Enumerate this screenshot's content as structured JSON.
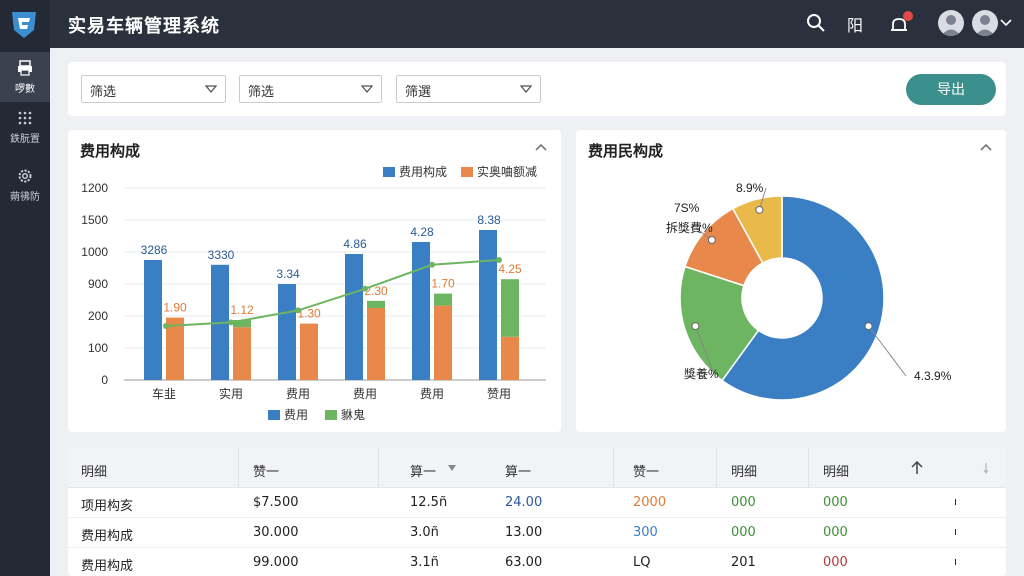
{
  "app": {
    "title": "实易车辆管理系统"
  },
  "topbar": {
    "text_icon": "阳"
  },
  "sidebar": {
    "items": [
      {
        "label": "啰數",
        "icon": "printer-icon"
      },
      {
        "label": "鉄朊置",
        "icon": "grid-dots-icon"
      },
      {
        "label": "蒴彿防",
        "icon": "gear-icon"
      }
    ]
  },
  "filters": {
    "items": [
      {
        "value": "筛选"
      },
      {
        "value": "筛选"
      },
      {
        "value": "筛選"
      }
    ],
    "export_label": "导出"
  },
  "bar_card": {
    "title": "费用构成"
  },
  "pie_card": {
    "title": "费用民构成"
  },
  "colors": {
    "blue": "#3a7fc4",
    "orange": "#e8884a",
    "green": "#6db561",
    "yellow": "#e9b94a",
    "teal": "#3b8f8c"
  },
  "chart_data": [
    {
      "type": "bar",
      "title": "费用构成",
      "legend_top": [
        "费用构成",
        "实奥㖆额减"
      ],
      "legend_bottom": [
        "费用",
        "貅鬼"
      ],
      "categories": [
        "车韭",
        "实用",
        "费用",
        "费用",
        "费用",
        "赞用"
      ],
      "yticks": [
        "0",
        "100",
        "200",
        "900",
        "1000",
        "1500",
        "1200"
      ],
      "series": [
        {
          "name": "费用构成",
          "color": "#3a7fc4",
          "values": [
            1000,
            960,
            800,
            1050,
            1150,
            1250
          ],
          "labels": [
            "3286",
            "3330",
            "3.34",
            "4.86",
            "4.28",
            "8.38"
          ]
        },
        {
          "name": "实奥㖆额减",
          "color": "#e8884a",
          "values": [
            520,
            440,
            470,
            600,
            620,
            360
          ],
          "labels": [
            "1.90",
            "1.12",
            "1.30",
            "2.30",
            "1.70",
            "4.25"
          ]
        },
        {
          "name": "貅鬼",
          "color": "#6db561",
          "values": [
            0,
            60,
            0,
            60,
            100,
            480
          ]
        }
      ],
      "line": {
        "color": "#6db561",
        "values": [
          450,
          480,
          580,
          760,
          960,
          1000
        ]
      }
    },
    {
      "type": "pie",
      "title": "费用民构成",
      "slices": [
        {
          "value": 60,
          "color": "#3a7fc4",
          "label": "4.3.9%"
        },
        {
          "value": 20,
          "color": "#6db561",
          "label": "獎養%"
        },
        {
          "value": 12,
          "color": "#e8884a",
          "label": "拆獎費%"
        },
        {
          "value": 8,
          "color": "#e9b94a",
          "label": "8.9%"
        }
      ],
      "extra_label": "7S%"
    }
  ],
  "table": {
    "headers": [
      "明细",
      "赞一",
      "算一",
      "算一",
      "赞一",
      "明细",
      "明细"
    ],
    "rows": [
      {
        "c0": "项用构亥",
        "c1": "$7.500",
        "c2": "12.5ñ",
        "c3": "24.00",
        "c4": "2000",
        "c5": "000",
        "c6": "000",
        "c7": "ı"
      },
      {
        "c0": "费用构成",
        "c1": "30.000",
        "c2": "3.0ñ",
        "c3": "13.00",
        "c4": "300",
        "c5": "000",
        "c6": "000",
        "c7": "ı"
      },
      {
        "c0": "费用构成",
        "c1": "99.000",
        "c2": "3.1ñ",
        "c3": "63.00",
        "c4": "LQ",
        "c5": "201",
        "c6": "000",
        "c7": "ı"
      }
    ]
  }
}
